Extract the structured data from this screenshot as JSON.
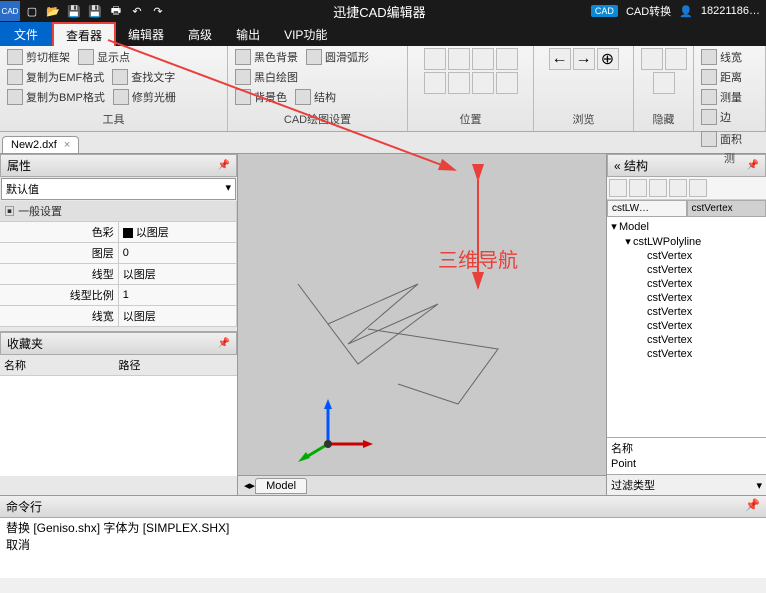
{
  "titlebar": {
    "app_title": "迅捷CAD编辑器",
    "convert": "CAD转换",
    "user": "18221186…"
  },
  "menubar": {
    "file": "文件",
    "tabs": [
      "查看器",
      "编辑器",
      "高级",
      "输出",
      "VIP功能"
    ]
  },
  "ribbon": {
    "groups": {
      "tool": {
        "label": "工具",
        "items": [
          "剪切框架",
          "复制为EMF格式",
          "复制为BMP格式",
          "显示点",
          "查找文字",
          "修剪光栅"
        ]
      },
      "cad_draw": {
        "label": "CAD绘图设置",
        "items": [
          "黑色背景",
          "黑白绘图",
          "背景色",
          "圆滑弧形",
          "结构"
        ]
      },
      "position": {
        "label": "位置"
      },
      "browse": {
        "label": "浏览"
      },
      "hide": {
        "label": "隐藏"
      },
      "measure": {
        "items": [
          "线宽",
          "测量",
          "距离",
          "边",
          "面积"
        ],
        "label": "测"
      }
    }
  },
  "doc_tab": {
    "name": "New2.dxf"
  },
  "properties": {
    "title": "属性",
    "default_combo": "默认值",
    "section": "一般设置",
    "rows": [
      {
        "k": "色彩",
        "v": "以图层"
      },
      {
        "k": "图层",
        "v": "0"
      },
      {
        "k": "线型",
        "v": "以图层"
      },
      {
        "k": "线型比例",
        "v": "1"
      },
      {
        "k": "线宽",
        "v": "以图层"
      }
    ]
  },
  "favorites": {
    "title": "收藏夹",
    "col_name": "名称",
    "col_path": "路径"
  },
  "canvas": {
    "model_tab": "Model",
    "annotation": "三维导航"
  },
  "structure": {
    "title": "结构",
    "tree_tabs": [
      "cstLW…",
      "cstVertex"
    ],
    "tree": {
      "root": "Model",
      "child": "cstLWPolyline",
      "leaves": [
        "cstVertex",
        "cstVertex",
        "cstVertex",
        "cstVertex",
        "cstVertex",
        "cstVertex",
        "cstVertex",
        "cstVertex"
      ]
    },
    "name_label": "名称",
    "name_value": "Point",
    "filter_label": "过滤类型"
  },
  "cmdline": {
    "title": "命令行",
    "lines": [
      "替换 [Geniso.shx] 字体为 [SIMPLEX.SHX]",
      "取消"
    ]
  }
}
